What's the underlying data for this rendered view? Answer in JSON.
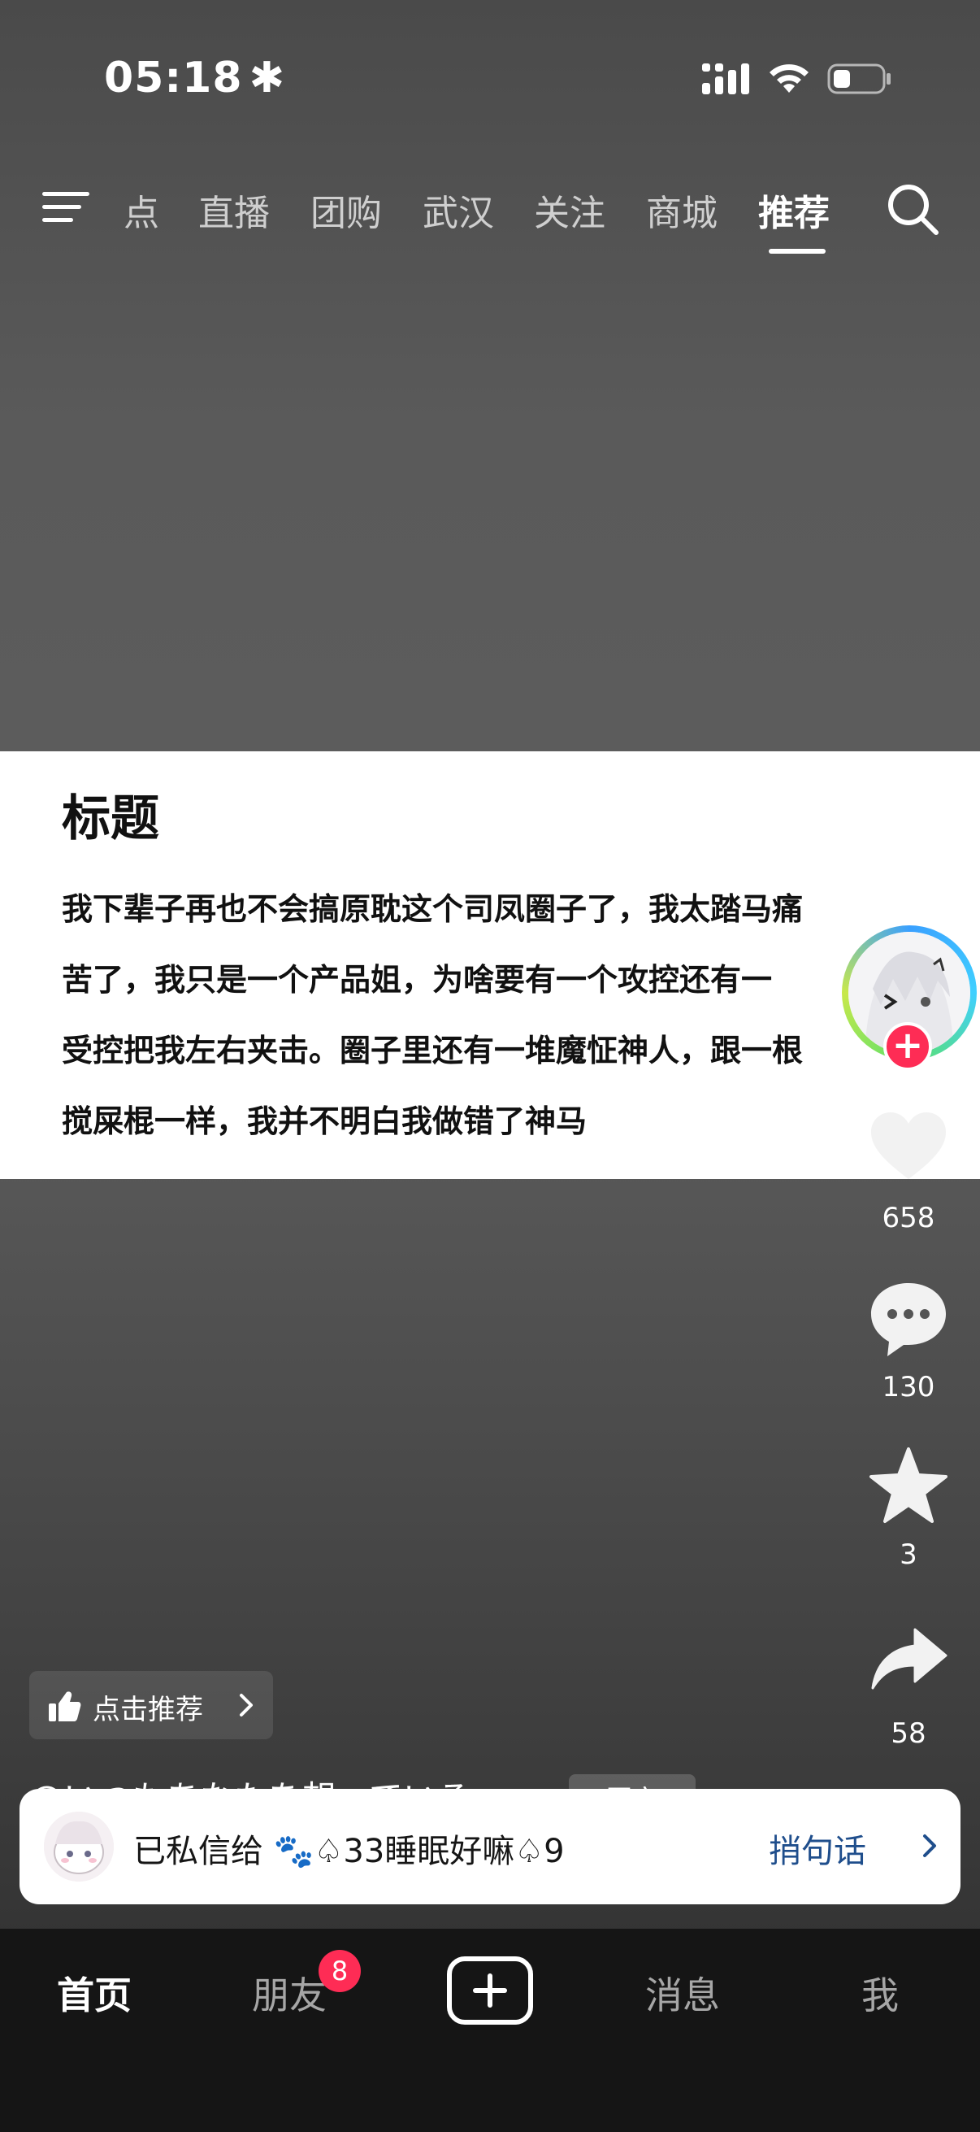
{
  "status_bar": {
    "time": "05:18",
    "time_suffix": "✱"
  },
  "top_nav": {
    "tabs": [
      {
        "label": "点"
      },
      {
        "label": "直播"
      },
      {
        "label": "团购"
      },
      {
        "label": "武汉"
      },
      {
        "label": "关注"
      },
      {
        "label": "商城"
      },
      {
        "label": "推荐"
      }
    ],
    "active_tab": "推荐"
  },
  "post_card": {
    "title": "标题",
    "lines": [
      "我下辈子再也不会搞原耽这个司凤圈子了，我太踏马痛",
      "苦了，我只是一个产品姐，为啥要有一个攻控还有一",
      "受控把我左右夹击。圈子里还有一堆魔怔神人，跟一根",
      "搅屎棍一样，我并不明白我做错了神马"
    ]
  },
  "actions": {
    "likes": "658",
    "comments": "130",
    "favorites": "3",
    "shares": "58"
  },
  "recommend_chip": {
    "label": "点击推荐"
  },
  "author_peek": {
    "text": "@いつもあなたを想っている",
    "tag": "图文"
  },
  "dm_toast": {
    "text": "已私信给 🐾♤33睡眠好嘛♤9",
    "action": "捎句话"
  },
  "bottom_nav": {
    "home": "首页",
    "friends": "朋友",
    "friends_badge": "8",
    "messages": "消息",
    "me": "我"
  },
  "colors": {
    "accent": "#fe2c55",
    "link": "#1f4e8c"
  }
}
